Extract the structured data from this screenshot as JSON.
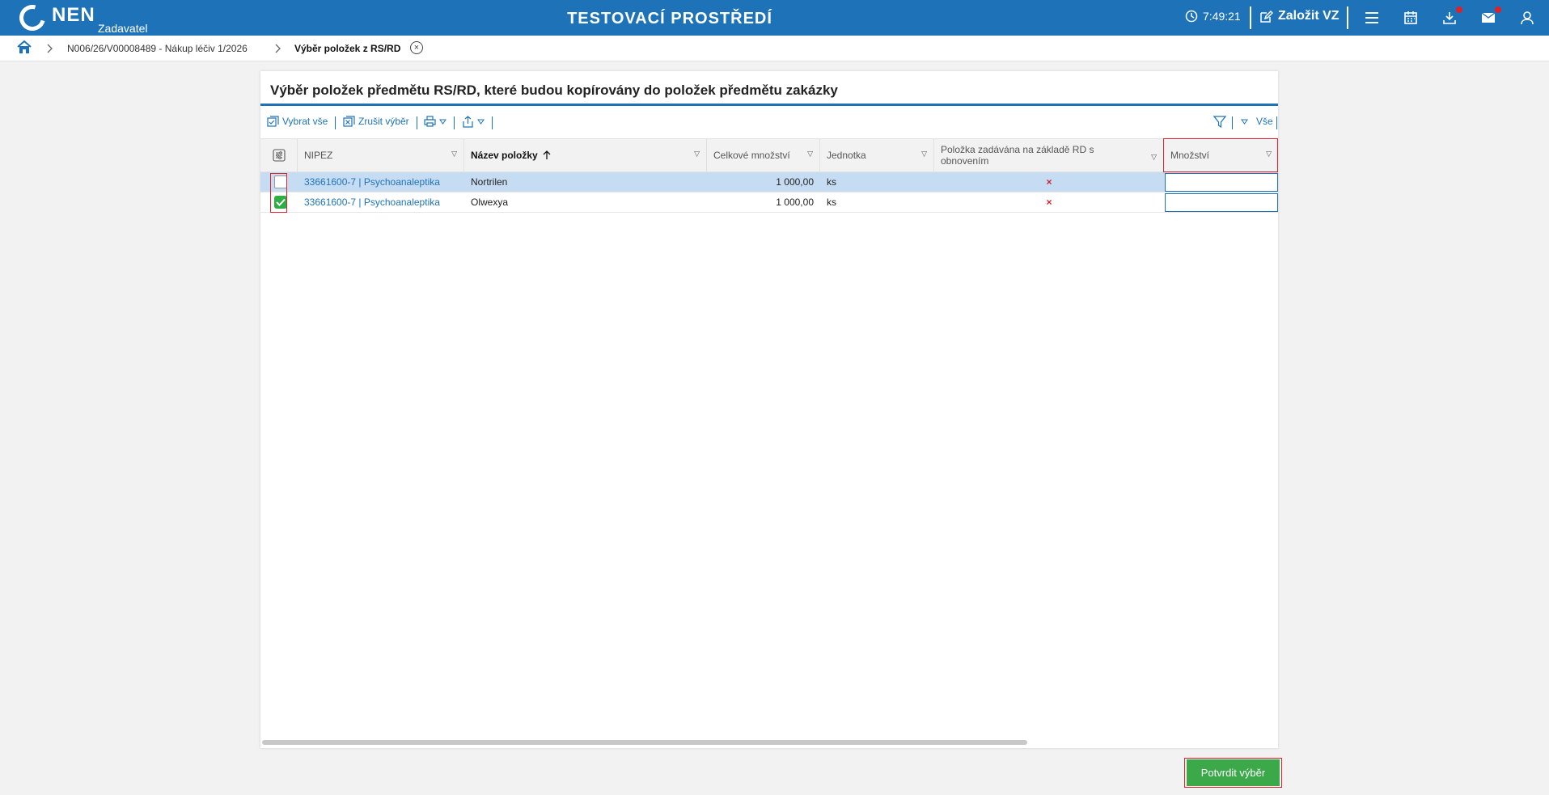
{
  "topbar": {
    "logo_text": "NEN",
    "logo_sub": "Zadavatel",
    "env_title": "TESTOVACÍ PROSTŘEDÍ",
    "time": "7:49:21",
    "create_label": "Založit VZ",
    "icons": [
      "clock-icon",
      "edit-icon",
      "menu-icon",
      "calendar-icon",
      "download-icon",
      "mail-icon",
      "user-icon"
    ]
  },
  "breadcrumb": {
    "item1": "N006/26/V00008489 - Nákup léčiv 1/2026",
    "item2": "Výběr položek z RS/RD"
  },
  "panel": {
    "title": "Výběr položek předmětu RS/RD, které budou kopírovány do položek předmětu zakázky"
  },
  "toolbar": {
    "select_all": "Vybrat vše",
    "cancel_selection": "Zrušit výběr",
    "filter_all": "Vše"
  },
  "grid": {
    "columns": {
      "nipez": "NIPEZ",
      "name": "Název položky",
      "total_qty": "Celkové množství",
      "unit": "Jednotka",
      "renewal": "Položka zadávána na základě RD s obnovením",
      "qty": "Množství"
    },
    "rows": [
      {
        "nipez": "33661600-7 | Psychoanaleptika",
        "name": "Nortrilen",
        "total_qty": "1 000,00",
        "unit": "ks",
        "renewal": "×",
        "qty": "",
        "checked": false,
        "highlighted": true
      },
      {
        "nipez": "33661600-7 | Psychoanaleptika",
        "name": "Olwexya",
        "total_qty": "1 000,00",
        "unit": "ks",
        "renewal": "×",
        "qty": "",
        "checked": true,
        "highlighted": false
      }
    ]
  },
  "footer": {
    "confirm_label": "Potvrdit výběr"
  },
  "colors": {
    "brand_blue": "#1e73b8",
    "confirm_green": "#3ba84a",
    "highlight_row": "#c6dcf3",
    "accent_red": "#e0202a"
  }
}
